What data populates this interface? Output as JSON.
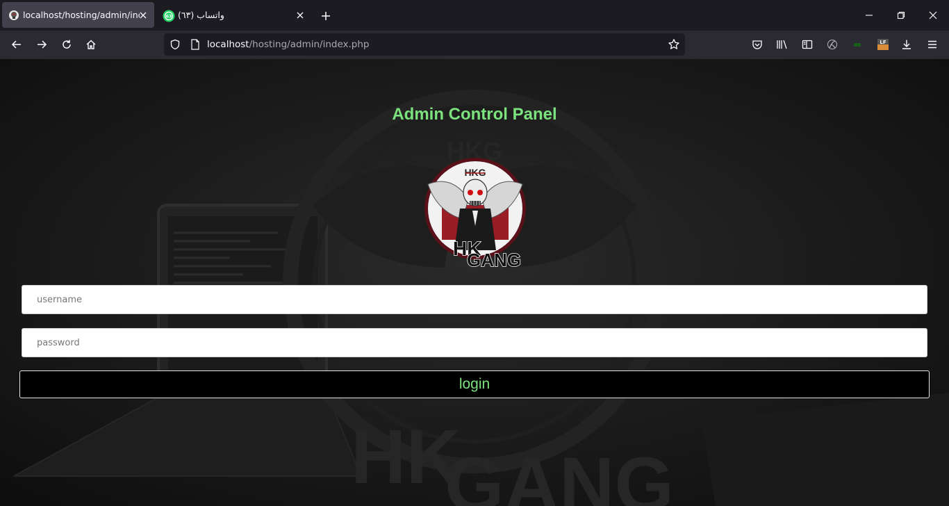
{
  "browser": {
    "tabs": [
      {
        "title": "localhost/hosting/admin/index.php",
        "active": true,
        "favicon": "skull-favicon"
      },
      {
        "title": "واتساب (٦٣)",
        "active": false,
        "favicon": "whatsapp-icon",
        "badge": "63"
      }
    ],
    "url": {
      "host": "localhost",
      "path": "/hosting/admin/index.php"
    },
    "accent": "#7ce27e"
  },
  "page": {
    "heading": "Admin Control Panel",
    "logo": {
      "top_text": "HKG",
      "bottom_text_1": "HK",
      "bottom_text_2": "GANG"
    },
    "background_text": {
      "line1": "HK",
      "line2": "GANG",
      "top": "HKG"
    },
    "form": {
      "username_placeholder": "username",
      "password_placeholder": "password",
      "login_label": "login"
    }
  }
}
